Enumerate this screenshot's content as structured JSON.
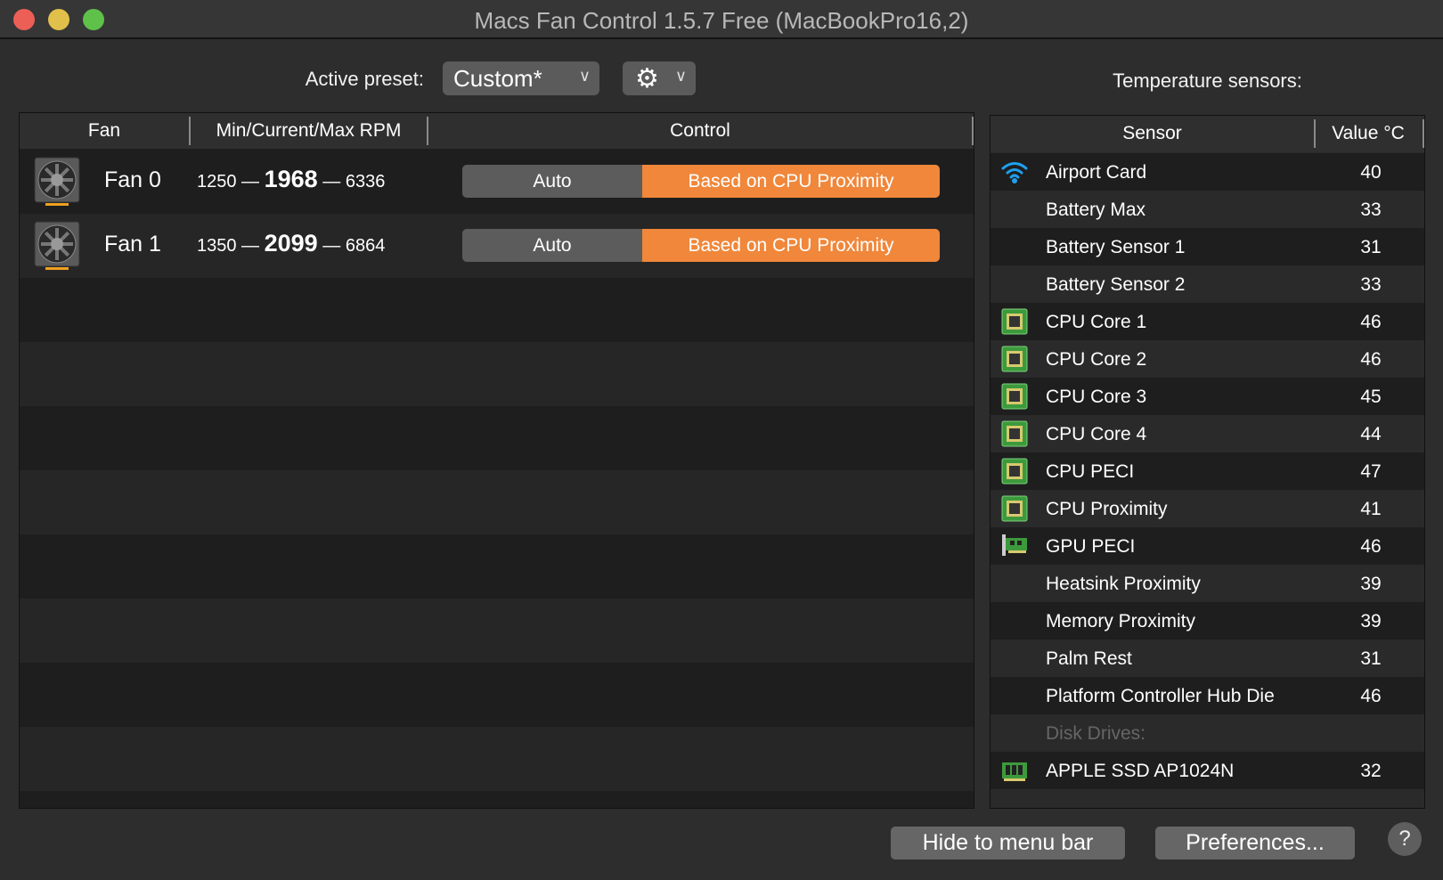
{
  "window": {
    "title": "Macs Fan Control 1.5.7 Free (MacBookPro16,2)"
  },
  "preset": {
    "label": "Active preset:",
    "value": "Custom*"
  },
  "sensors_title": "Temperature sensors:",
  "fan_table": {
    "headers": [
      "Fan",
      "Min/Current/Max RPM",
      "Control"
    ],
    "fans": [
      {
        "name": "Fan 0",
        "min": "1250",
        "current": "1968",
        "max": "6336",
        "auto_label": "Auto",
        "control_label": "Based on CPU Proximity"
      },
      {
        "name": "Fan 1",
        "min": "1350",
        "current": "2099",
        "max": "6864",
        "auto_label": "Auto",
        "control_label": "Based on CPU Proximity"
      }
    ]
  },
  "sensor_table": {
    "headers": [
      "Sensor",
      "Value °C"
    ],
    "rows": [
      {
        "icon": "wifi",
        "name": "Airport Card",
        "value": "40"
      },
      {
        "icon": "",
        "name": "Battery Max",
        "value": "33"
      },
      {
        "icon": "",
        "name": "Battery Sensor 1",
        "value": "31"
      },
      {
        "icon": "",
        "name": "Battery Sensor 2",
        "value": "33"
      },
      {
        "icon": "cpu",
        "name": "CPU Core 1",
        "value": "46"
      },
      {
        "icon": "cpu",
        "name": "CPU Core 2",
        "value": "46"
      },
      {
        "icon": "cpu",
        "name": "CPU Core 3",
        "value": "45"
      },
      {
        "icon": "cpu",
        "name": "CPU Core 4",
        "value": "44"
      },
      {
        "icon": "cpu",
        "name": "CPU PECI",
        "value": "47"
      },
      {
        "icon": "cpu",
        "name": "CPU Proximity",
        "value": "41"
      },
      {
        "icon": "gpu",
        "name": "GPU PECI",
        "value": "46"
      },
      {
        "icon": "",
        "name": "Heatsink Proximity",
        "value": "39"
      },
      {
        "icon": "",
        "name": "Memory Proximity",
        "value": "39"
      },
      {
        "icon": "",
        "name": "Palm Rest",
        "value": "31"
      },
      {
        "icon": "",
        "name": "Platform Controller Hub Die",
        "value": "46"
      },
      {
        "icon": "",
        "name": "Disk Drives:",
        "value": "",
        "section": true
      },
      {
        "icon": "ssd",
        "name": "APPLE SSD AP1024N",
        "value": "32"
      }
    ]
  },
  "buttons": {
    "hide": "Hide to menu bar",
    "preferences": "Preferences...",
    "help": "?"
  },
  "colors": {
    "accent": "#f0873a",
    "close": "#ec5f57",
    "minimize": "#e0c04a",
    "zoom": "#5fc14a"
  }
}
